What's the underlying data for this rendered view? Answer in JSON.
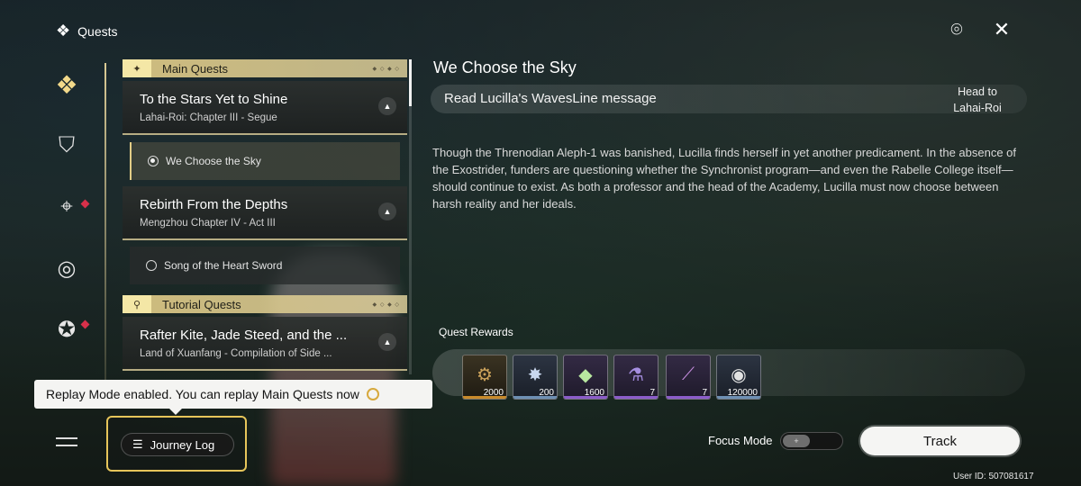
{
  "header": {
    "title": "Quests"
  },
  "nav": {
    "items": [
      {
        "icon": "quests-diamond-icon",
        "active": true
      },
      {
        "icon": "shield-star-icon",
        "active": false
      },
      {
        "icon": "map-pin-icon",
        "active": false,
        "alert": true
      },
      {
        "icon": "target-circle-icon",
        "active": false
      },
      {
        "icon": "star-refresh-icon",
        "active": false,
        "alert": true
      },
      {
        "icon": "menu-lines-icon",
        "active": false
      }
    ]
  },
  "quest_list": {
    "main_category": "Main Quests",
    "tutorial_category": "Tutorial Quests",
    "quests": [
      {
        "title": "To the Stars Yet to Shine",
        "subtitle": "Lahai-Roi: Chapter III - Segue"
      },
      {
        "title": "Rebirth From the Depths",
        "subtitle": "Mengzhou Chapter IV - Act III"
      },
      {
        "title": "Rafter Kite, Jade Steed, and the ...",
        "subtitle": "Land of Xuanfang - Compilation of Side ..."
      }
    ],
    "sub_quests": [
      {
        "label": "We Choose the Sky",
        "active": true
      },
      {
        "label": "Song of the Heart Sword",
        "active": false
      }
    ]
  },
  "toast": {
    "message": "Replay Mode enabled. You can replay Main Quests now"
  },
  "journey_log": {
    "label": "Journey Log"
  },
  "detail": {
    "title": "We Choose the Sky",
    "objective": "Read Lucilla's WavesLine message",
    "destination_line1": "Head to",
    "destination_line2": "Lahai-Roi",
    "description": "Though the Threnodian Aleph-1 was banished, Lucilla finds herself in yet another predicament. In the absence of the Exostrider, funders are questioning whether the Synchronist program—and even the Rabelle College itself—should continue to exist. As both a professor and the head of the Academy, Lucilla must now choose between harsh reality and her ideals."
  },
  "rewards": {
    "label": "Quest Rewards",
    "items": [
      {
        "icon": "gear-ring-icon",
        "qty": "2000",
        "rarity_color": "#c98a2a"
      },
      {
        "icon": "star-crystal-icon",
        "qty": "200",
        "rarity_color": "#6d8fb3"
      },
      {
        "icon": "green-crystal-icon",
        "qty": "1600",
        "rarity_color": "#8b5cc9"
      },
      {
        "icon": "purple-vial-icon",
        "qty": "7",
        "rarity_color": "#8b5cc9"
      },
      {
        "icon": "purple-tube-icon",
        "qty": "7",
        "rarity_color": "#8b5cc9"
      },
      {
        "icon": "silver-coin-icon",
        "qty": "120000",
        "rarity_color": "#6d8fb3"
      }
    ]
  },
  "controls": {
    "focus_mode_label": "Focus Mode",
    "track_label": "Track"
  },
  "footer": {
    "user_id": "User ID: 507081617"
  }
}
